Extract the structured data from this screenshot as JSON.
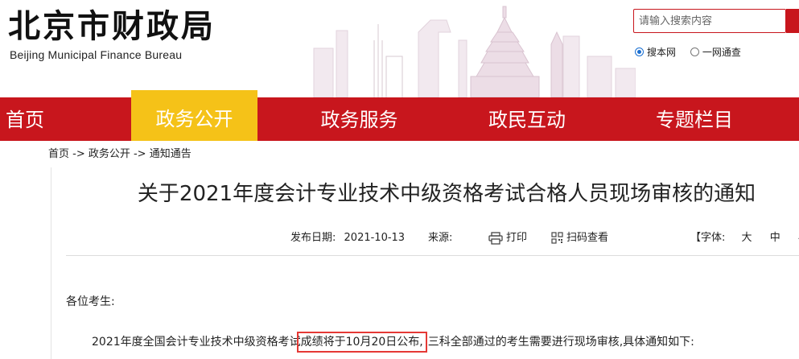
{
  "header": {
    "logo_cn": "北京市财政局",
    "logo_en": "Beijing Municipal Finance Bureau"
  },
  "search": {
    "placeholder": "请输入搜索内容",
    "options": [
      {
        "label": "搜本网",
        "selected": true
      },
      {
        "label": "一网通查",
        "selected": false
      }
    ]
  },
  "nav": {
    "items": [
      {
        "label": "首页",
        "active": false
      },
      {
        "label": "政务公开",
        "active": true
      },
      {
        "label": "政务服务",
        "active": false
      },
      {
        "label": "政民互动",
        "active": false
      },
      {
        "label": "专题栏目",
        "active": false
      }
    ]
  },
  "breadcrumb": "首页 -> 政务公开 -> 通知通告",
  "article": {
    "title": "关于2021年度会计专业技术中级资格考试合格人员现场审核的通知",
    "date_label": "发布日期:",
    "date": "2021-10-13",
    "source_label": "来源:",
    "print_label": "打印",
    "qr_label": "扫码查看",
    "font_label": "【字体:",
    "font_sizes": [
      "大",
      "中",
      "小"
    ],
    "salutation": "各位考生:",
    "para_before": "2021年度全国会计专业技术中级资格考试",
    "para_highlight": "成绩将于10月20日公布,",
    "para_after": "三科全部通过的考生需要进行现场审核,具体通知如下:"
  },
  "colors": {
    "nav_red": "#c8161d",
    "nav_active_yellow": "#f5c218",
    "highlight_box": "#e53935"
  }
}
